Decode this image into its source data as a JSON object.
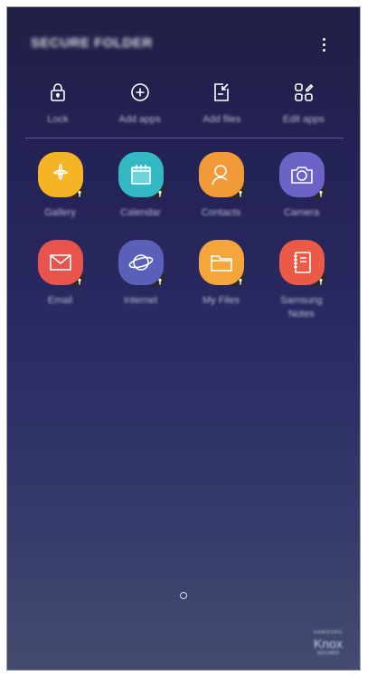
{
  "header": {
    "title": "SECURE FOLDER",
    "more_icon": "more-vertical-icon"
  },
  "actions": [
    {
      "label": "Lock",
      "icon": "lock-icon"
    },
    {
      "label": "Add apps",
      "icon": "add-circle-icon"
    },
    {
      "label": "Add files",
      "icon": "add-file-icon"
    },
    {
      "label": "Edit apps",
      "icon": "edit-apps-icon"
    }
  ],
  "apps": [
    {
      "label": "Gallery",
      "icon": "gallery-icon",
      "color": "#f5b326"
    },
    {
      "label": "Calendar",
      "icon": "calendar-icon",
      "color": "#33b9c4"
    },
    {
      "label": "Contacts",
      "icon": "contacts-icon",
      "color": "#f29a38"
    },
    {
      "label": "Camera",
      "icon": "camera-icon",
      "color": "#6b64c6"
    },
    {
      "label": "Email",
      "icon": "email-icon",
      "color": "#e8544c"
    },
    {
      "label": "Internet",
      "icon": "internet-icon",
      "color": "#5a5fb8"
    },
    {
      "label": "My Files",
      "icon": "folder-icon",
      "color": "#f4a63a"
    },
    {
      "label": "Samsung Notes",
      "icon": "notes-icon",
      "color": "#ea5a47"
    }
  ],
  "footer": {
    "brand_top": "SAMSUNG",
    "brand": "Knox",
    "brand_sub": "SECURED"
  }
}
